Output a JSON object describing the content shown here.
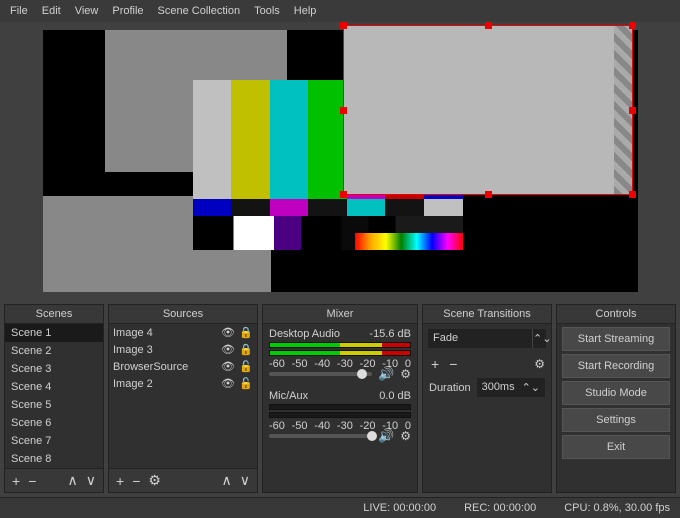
{
  "menu": [
    "File",
    "Edit",
    "View",
    "Profile",
    "Scene Collection",
    "Tools",
    "Help"
  ],
  "panels": {
    "scenes": {
      "title": "Scenes",
      "items": [
        "Scene 1",
        "Scene 2",
        "Scene 3",
        "Scene 4",
        "Scene 5",
        "Scene 6",
        "Scene 7",
        "Scene 8"
      ],
      "selected": 0
    },
    "sources": {
      "title": "Sources",
      "items": [
        {
          "name": "Image 4",
          "visible": true,
          "locked": true
        },
        {
          "name": "Image 3",
          "visible": true,
          "locked": true
        },
        {
          "name": "BrowserSource",
          "visible": true,
          "locked": false
        },
        {
          "name": "Image 2",
          "visible": true,
          "locked": false
        }
      ],
      "selected": 0
    },
    "mixer": {
      "title": "Mixer",
      "channels": [
        {
          "name": "Desktop Audio",
          "db": "-15.6 dB",
          "pos": 85
        },
        {
          "name": "Mic/Aux",
          "db": "0.0 dB",
          "pos": 95
        }
      ]
    },
    "transitions": {
      "title": "Scene Transitions",
      "type": "Fade",
      "duration_label": "Duration",
      "duration_value": "300ms"
    },
    "controls": {
      "title": "Controls",
      "buttons": [
        "Start Streaming",
        "Start Recording",
        "Studio Mode",
        "Settings",
        "Exit"
      ]
    }
  },
  "status": {
    "live": "LIVE: 00:00:00",
    "rec": "REC: 00:00:00",
    "cpu": "CPU: 0.8%, 30.00 fps"
  }
}
